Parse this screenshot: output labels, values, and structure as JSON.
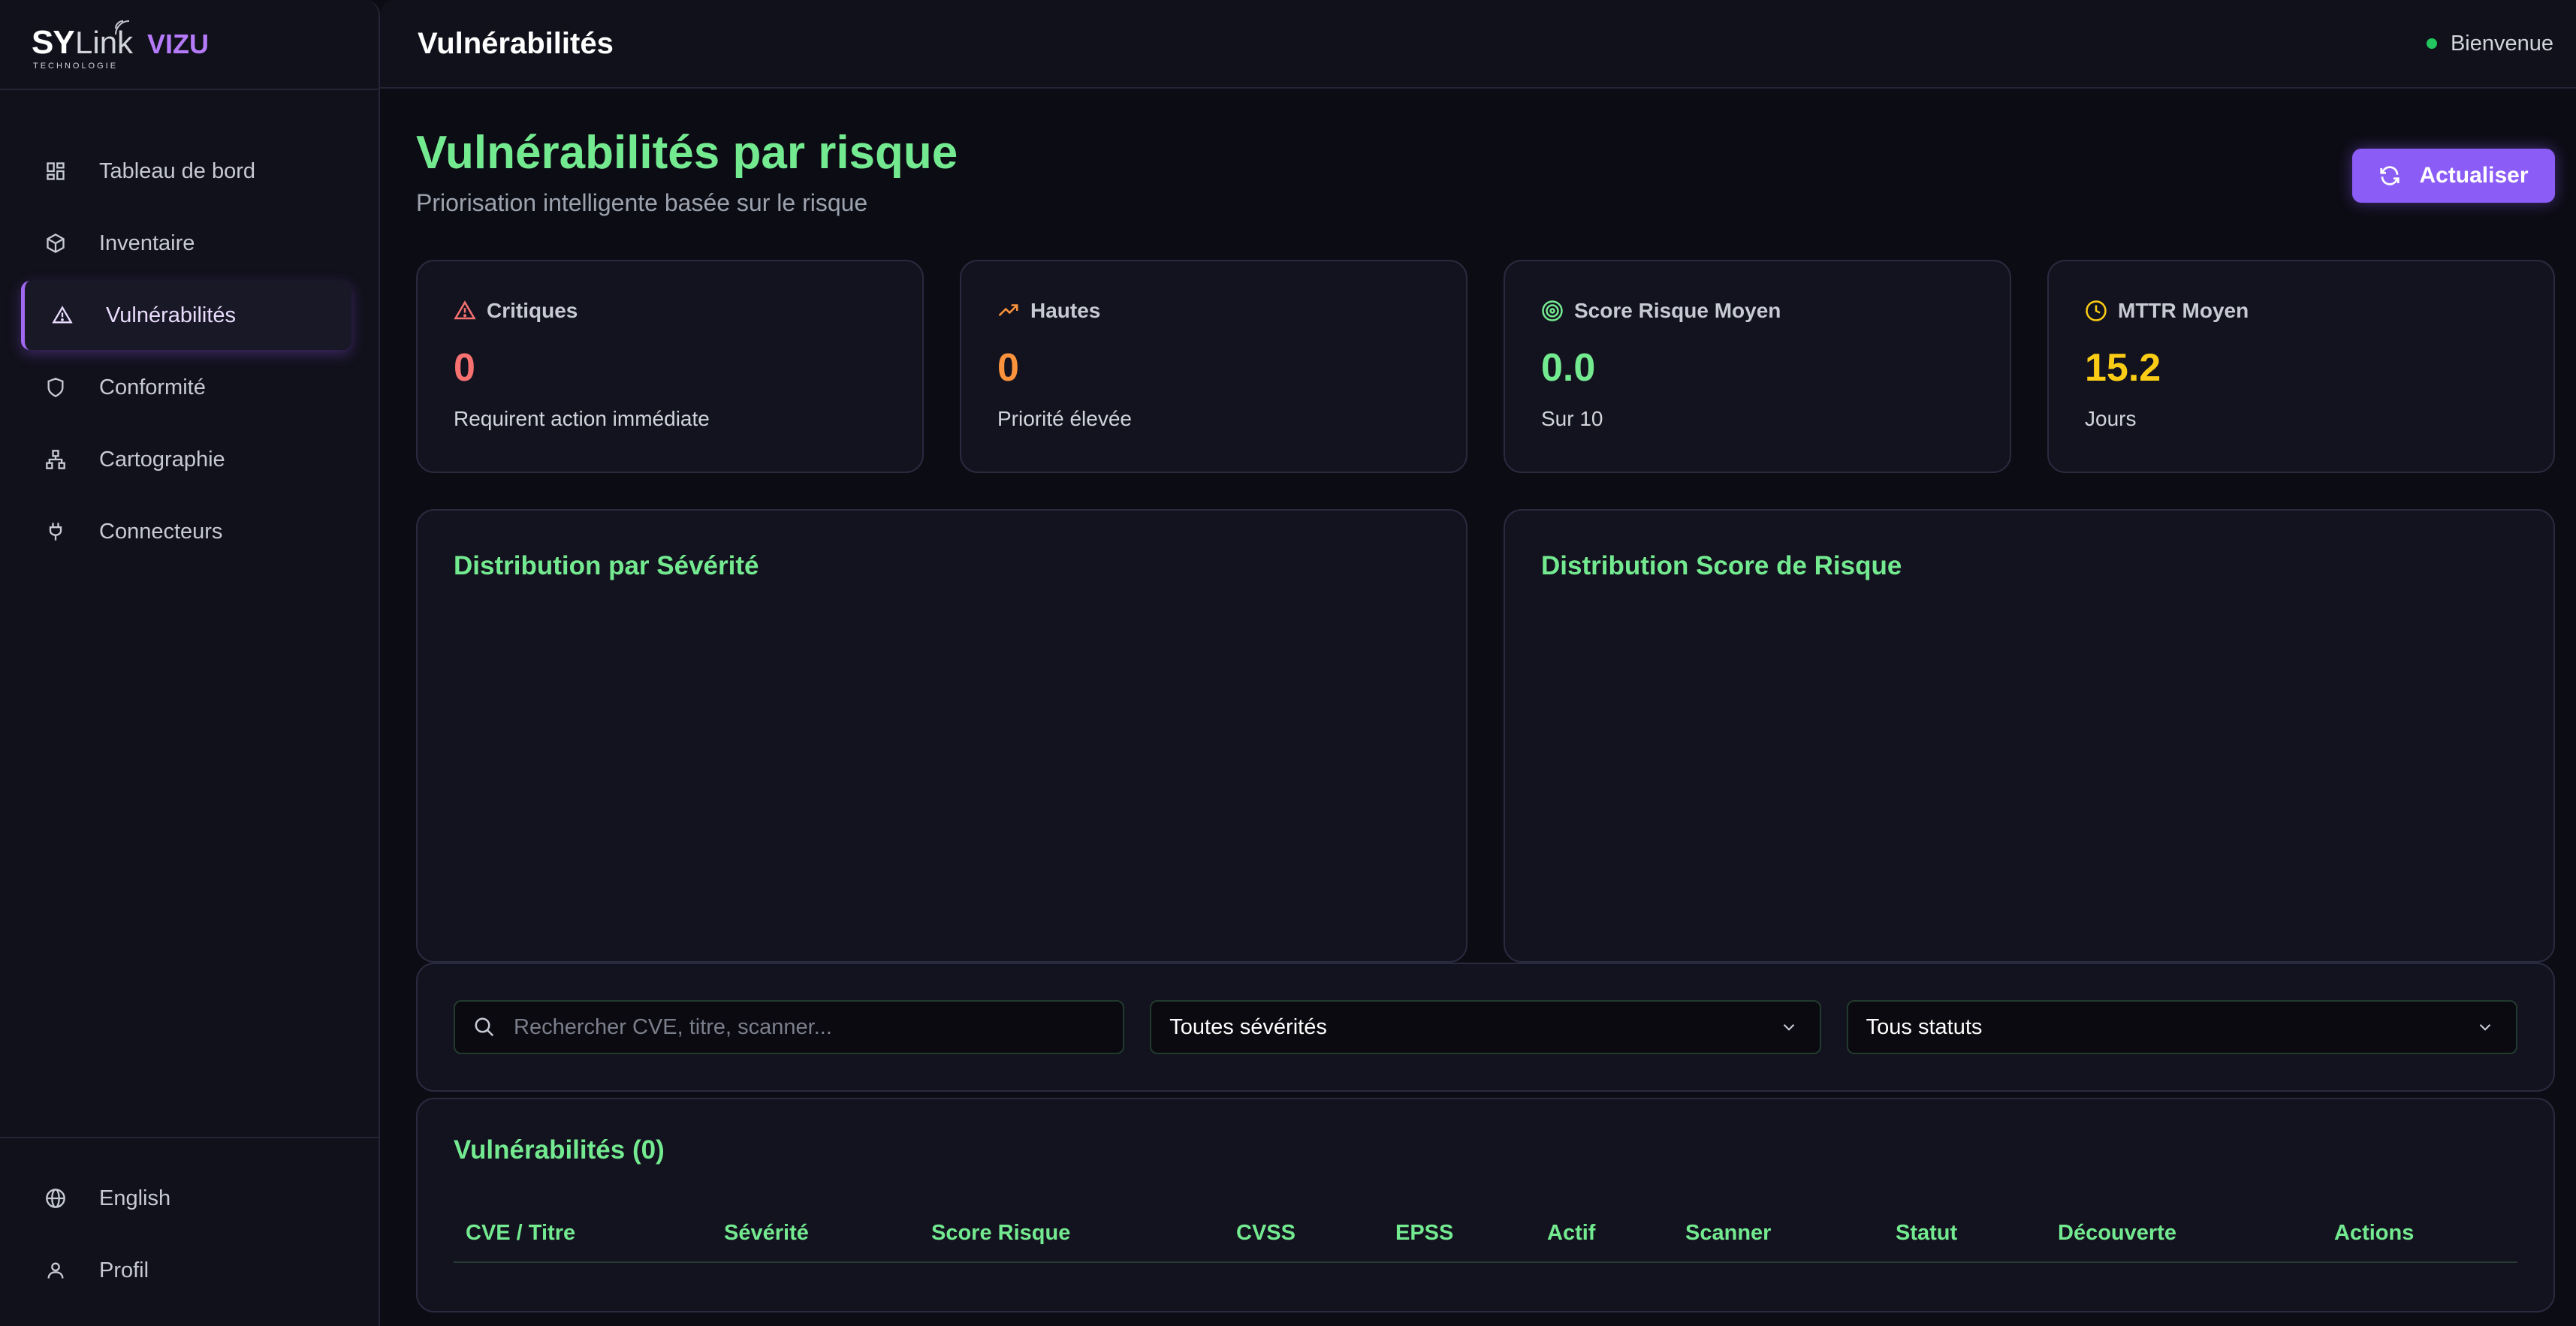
{
  "brand": {
    "logo_main": "SY",
    "logo_link": "Link",
    "logo_sub": "TECHNOLOGIE",
    "product": "VIZU"
  },
  "sidebar": {
    "items": [
      {
        "label": "Tableau de bord",
        "icon": "dashboard-icon"
      },
      {
        "label": "Inventaire",
        "icon": "box-icon"
      },
      {
        "label": "Vulnérabilités",
        "icon": "warning-icon",
        "active": true
      },
      {
        "label": "Conformité",
        "icon": "shield-icon"
      },
      {
        "label": "Cartographie",
        "icon": "network-icon"
      },
      {
        "label": "Connecteurs",
        "icon": "plug-icon"
      }
    ],
    "bottom": [
      {
        "label": "English",
        "icon": "globe-icon"
      },
      {
        "label": "Profil",
        "icon": "user-icon"
      }
    ]
  },
  "header": {
    "title": "Vulnérabilités",
    "welcome": "Bienvenue"
  },
  "page": {
    "title": "Vulnérabilités par risque",
    "subtitle": "Priorisation intelligente basée sur le risque",
    "refresh_label": "Actualiser"
  },
  "stats": [
    {
      "label": "Critiques",
      "value": "0",
      "note": "Requirent action immédiate",
      "color": "#f87171",
      "icon": "warning-icon"
    },
    {
      "label": "Hautes",
      "value": "0",
      "note": "Priorité élevée",
      "color": "#fb923c",
      "icon": "trending-up-icon"
    },
    {
      "label": "Score Risque Moyen",
      "value": "0.0",
      "note": "Sur 10",
      "color": "#74ea90",
      "icon": "target-icon"
    },
    {
      "label": "MTTR Moyen",
      "value": "15.2",
      "note": "Jours",
      "color": "#facc15",
      "icon": "clock-icon"
    }
  ],
  "charts": {
    "severity_title": "Distribution par Sévérité",
    "risk_title": "Distribution Score de Risque"
  },
  "filters": {
    "search_placeholder": "Rechercher CVE, titre, scanner...",
    "severity_selected": "Toutes sévérités",
    "status_selected": "Tous statuts"
  },
  "table": {
    "title": "Vulnérabilités (0)",
    "columns": [
      "CVE / Titre",
      "Sévérité",
      "Score Risque",
      "CVSS",
      "EPSS",
      "Actif",
      "Scanner",
      "Statut",
      "Découverte",
      "Actions"
    ]
  }
}
